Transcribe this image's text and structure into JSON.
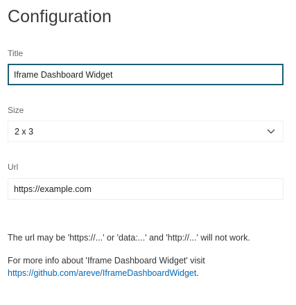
{
  "page": {
    "title": "Configuration"
  },
  "fields": {
    "title": {
      "label": "Title",
      "value": "Iframe Dashboard Widget"
    },
    "size": {
      "label": "Size",
      "value": "2 x 3"
    },
    "url": {
      "label": "Url",
      "value": "https://example.com"
    }
  },
  "notes": {
    "url_rule": "The url may be 'https://...' or 'data:...' and 'http://...' will not work.",
    "more_info_prefix": "For more info about 'Iframe Dashboard Widget' visit",
    "more_info_link": "https://github.com/areve/IframeDashboardWidget",
    "more_info_suffix": "."
  },
  "icons": {
    "size_dropdown": "chevron-down-icon"
  },
  "colors": {
    "focus_border": "#1e5f74",
    "link": "#0067b8"
  }
}
